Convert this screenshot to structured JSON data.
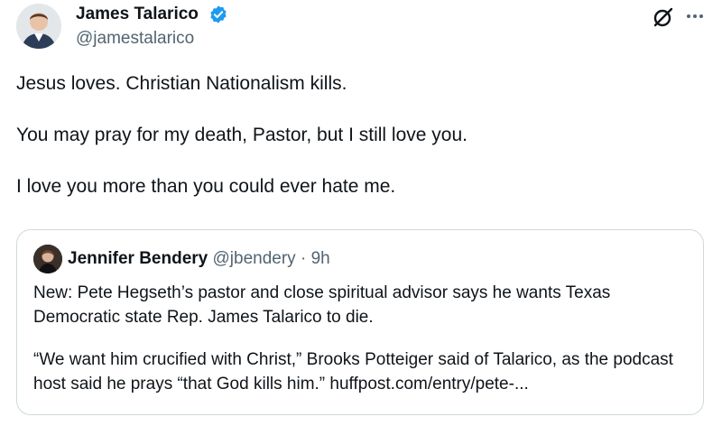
{
  "tweet": {
    "author": {
      "name": "James Talarico",
      "handle": "@jamestalarico",
      "verified": true
    },
    "paragraphs": [
      "Jesus loves. Christian Nationalism kills.",
      "You may pray for my death, Pastor, but I still love you.",
      "I love you more than you could ever hate me."
    ],
    "icons": {
      "grok": "grok-icon",
      "more": "more-icon",
      "verified": "verified-badge-icon"
    }
  },
  "quote": {
    "name": "Jennifer Bendery",
    "handle": "@jbendery",
    "separator": "·",
    "time": "9h",
    "paragraphs": [
      "New: Pete Hegseth’s pastor and close spiritual advisor says he wants Texas Democratic state Rep. James Talarico to die.",
      "“We want him crucified with Christ,” Brooks Potteiger said of Talarico, as the podcast host said he prays “that God kills him.” huffpost.com/entry/pete-..."
    ]
  },
  "colors": {
    "text": "#0f1419",
    "secondary": "#536471",
    "verified": "#1d9bf0",
    "border": "#cfd9de"
  }
}
